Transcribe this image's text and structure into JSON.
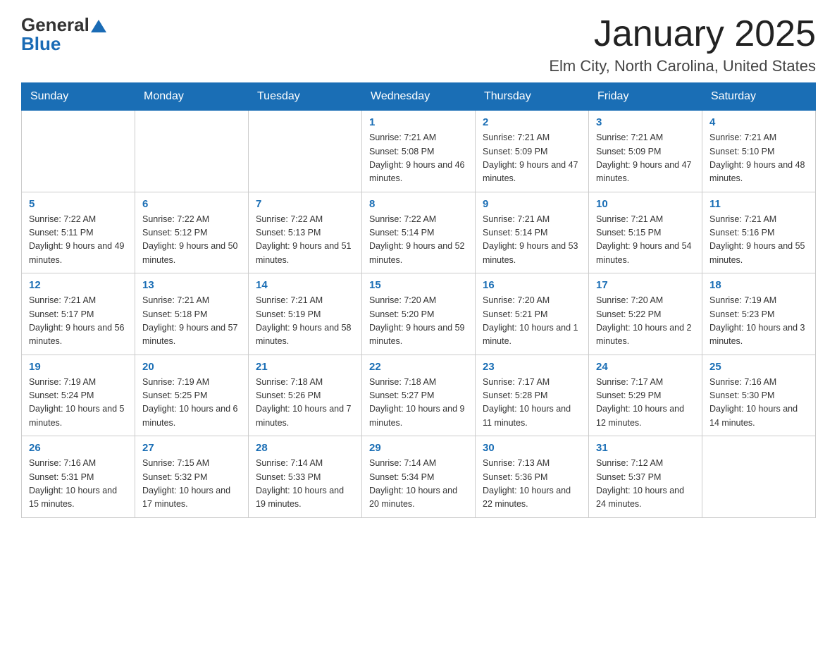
{
  "logo": {
    "text_general": "General",
    "triangle": "▲",
    "text_blue": "Blue"
  },
  "title": {
    "month": "January 2025",
    "location": "Elm City, North Carolina, United States"
  },
  "days_of_week": [
    "Sunday",
    "Monday",
    "Tuesday",
    "Wednesday",
    "Thursday",
    "Friday",
    "Saturday"
  ],
  "weeks": [
    [
      {
        "day": "",
        "info": ""
      },
      {
        "day": "",
        "info": ""
      },
      {
        "day": "",
        "info": ""
      },
      {
        "day": "1",
        "info": "Sunrise: 7:21 AM\nSunset: 5:08 PM\nDaylight: 9 hours and 46 minutes."
      },
      {
        "day": "2",
        "info": "Sunrise: 7:21 AM\nSunset: 5:09 PM\nDaylight: 9 hours and 47 minutes."
      },
      {
        "day": "3",
        "info": "Sunrise: 7:21 AM\nSunset: 5:09 PM\nDaylight: 9 hours and 47 minutes."
      },
      {
        "day": "4",
        "info": "Sunrise: 7:21 AM\nSunset: 5:10 PM\nDaylight: 9 hours and 48 minutes."
      }
    ],
    [
      {
        "day": "5",
        "info": "Sunrise: 7:22 AM\nSunset: 5:11 PM\nDaylight: 9 hours and 49 minutes."
      },
      {
        "day": "6",
        "info": "Sunrise: 7:22 AM\nSunset: 5:12 PM\nDaylight: 9 hours and 50 minutes."
      },
      {
        "day": "7",
        "info": "Sunrise: 7:22 AM\nSunset: 5:13 PM\nDaylight: 9 hours and 51 minutes."
      },
      {
        "day": "8",
        "info": "Sunrise: 7:22 AM\nSunset: 5:14 PM\nDaylight: 9 hours and 52 minutes."
      },
      {
        "day": "9",
        "info": "Sunrise: 7:21 AM\nSunset: 5:14 PM\nDaylight: 9 hours and 53 minutes."
      },
      {
        "day": "10",
        "info": "Sunrise: 7:21 AM\nSunset: 5:15 PM\nDaylight: 9 hours and 54 minutes."
      },
      {
        "day": "11",
        "info": "Sunrise: 7:21 AM\nSunset: 5:16 PM\nDaylight: 9 hours and 55 minutes."
      }
    ],
    [
      {
        "day": "12",
        "info": "Sunrise: 7:21 AM\nSunset: 5:17 PM\nDaylight: 9 hours and 56 minutes."
      },
      {
        "day": "13",
        "info": "Sunrise: 7:21 AM\nSunset: 5:18 PM\nDaylight: 9 hours and 57 minutes."
      },
      {
        "day": "14",
        "info": "Sunrise: 7:21 AM\nSunset: 5:19 PM\nDaylight: 9 hours and 58 minutes."
      },
      {
        "day": "15",
        "info": "Sunrise: 7:20 AM\nSunset: 5:20 PM\nDaylight: 9 hours and 59 minutes."
      },
      {
        "day": "16",
        "info": "Sunrise: 7:20 AM\nSunset: 5:21 PM\nDaylight: 10 hours and 1 minute."
      },
      {
        "day": "17",
        "info": "Sunrise: 7:20 AM\nSunset: 5:22 PM\nDaylight: 10 hours and 2 minutes."
      },
      {
        "day": "18",
        "info": "Sunrise: 7:19 AM\nSunset: 5:23 PM\nDaylight: 10 hours and 3 minutes."
      }
    ],
    [
      {
        "day": "19",
        "info": "Sunrise: 7:19 AM\nSunset: 5:24 PM\nDaylight: 10 hours and 5 minutes."
      },
      {
        "day": "20",
        "info": "Sunrise: 7:19 AM\nSunset: 5:25 PM\nDaylight: 10 hours and 6 minutes."
      },
      {
        "day": "21",
        "info": "Sunrise: 7:18 AM\nSunset: 5:26 PM\nDaylight: 10 hours and 7 minutes."
      },
      {
        "day": "22",
        "info": "Sunrise: 7:18 AM\nSunset: 5:27 PM\nDaylight: 10 hours and 9 minutes."
      },
      {
        "day": "23",
        "info": "Sunrise: 7:17 AM\nSunset: 5:28 PM\nDaylight: 10 hours and 11 minutes."
      },
      {
        "day": "24",
        "info": "Sunrise: 7:17 AM\nSunset: 5:29 PM\nDaylight: 10 hours and 12 minutes."
      },
      {
        "day": "25",
        "info": "Sunrise: 7:16 AM\nSunset: 5:30 PM\nDaylight: 10 hours and 14 minutes."
      }
    ],
    [
      {
        "day": "26",
        "info": "Sunrise: 7:16 AM\nSunset: 5:31 PM\nDaylight: 10 hours and 15 minutes."
      },
      {
        "day": "27",
        "info": "Sunrise: 7:15 AM\nSunset: 5:32 PM\nDaylight: 10 hours and 17 minutes."
      },
      {
        "day": "28",
        "info": "Sunrise: 7:14 AM\nSunset: 5:33 PM\nDaylight: 10 hours and 19 minutes."
      },
      {
        "day": "29",
        "info": "Sunrise: 7:14 AM\nSunset: 5:34 PM\nDaylight: 10 hours and 20 minutes."
      },
      {
        "day": "30",
        "info": "Sunrise: 7:13 AM\nSunset: 5:36 PM\nDaylight: 10 hours and 22 minutes."
      },
      {
        "day": "31",
        "info": "Sunrise: 7:12 AM\nSunset: 5:37 PM\nDaylight: 10 hours and 24 minutes."
      },
      {
        "day": "",
        "info": ""
      }
    ]
  ]
}
